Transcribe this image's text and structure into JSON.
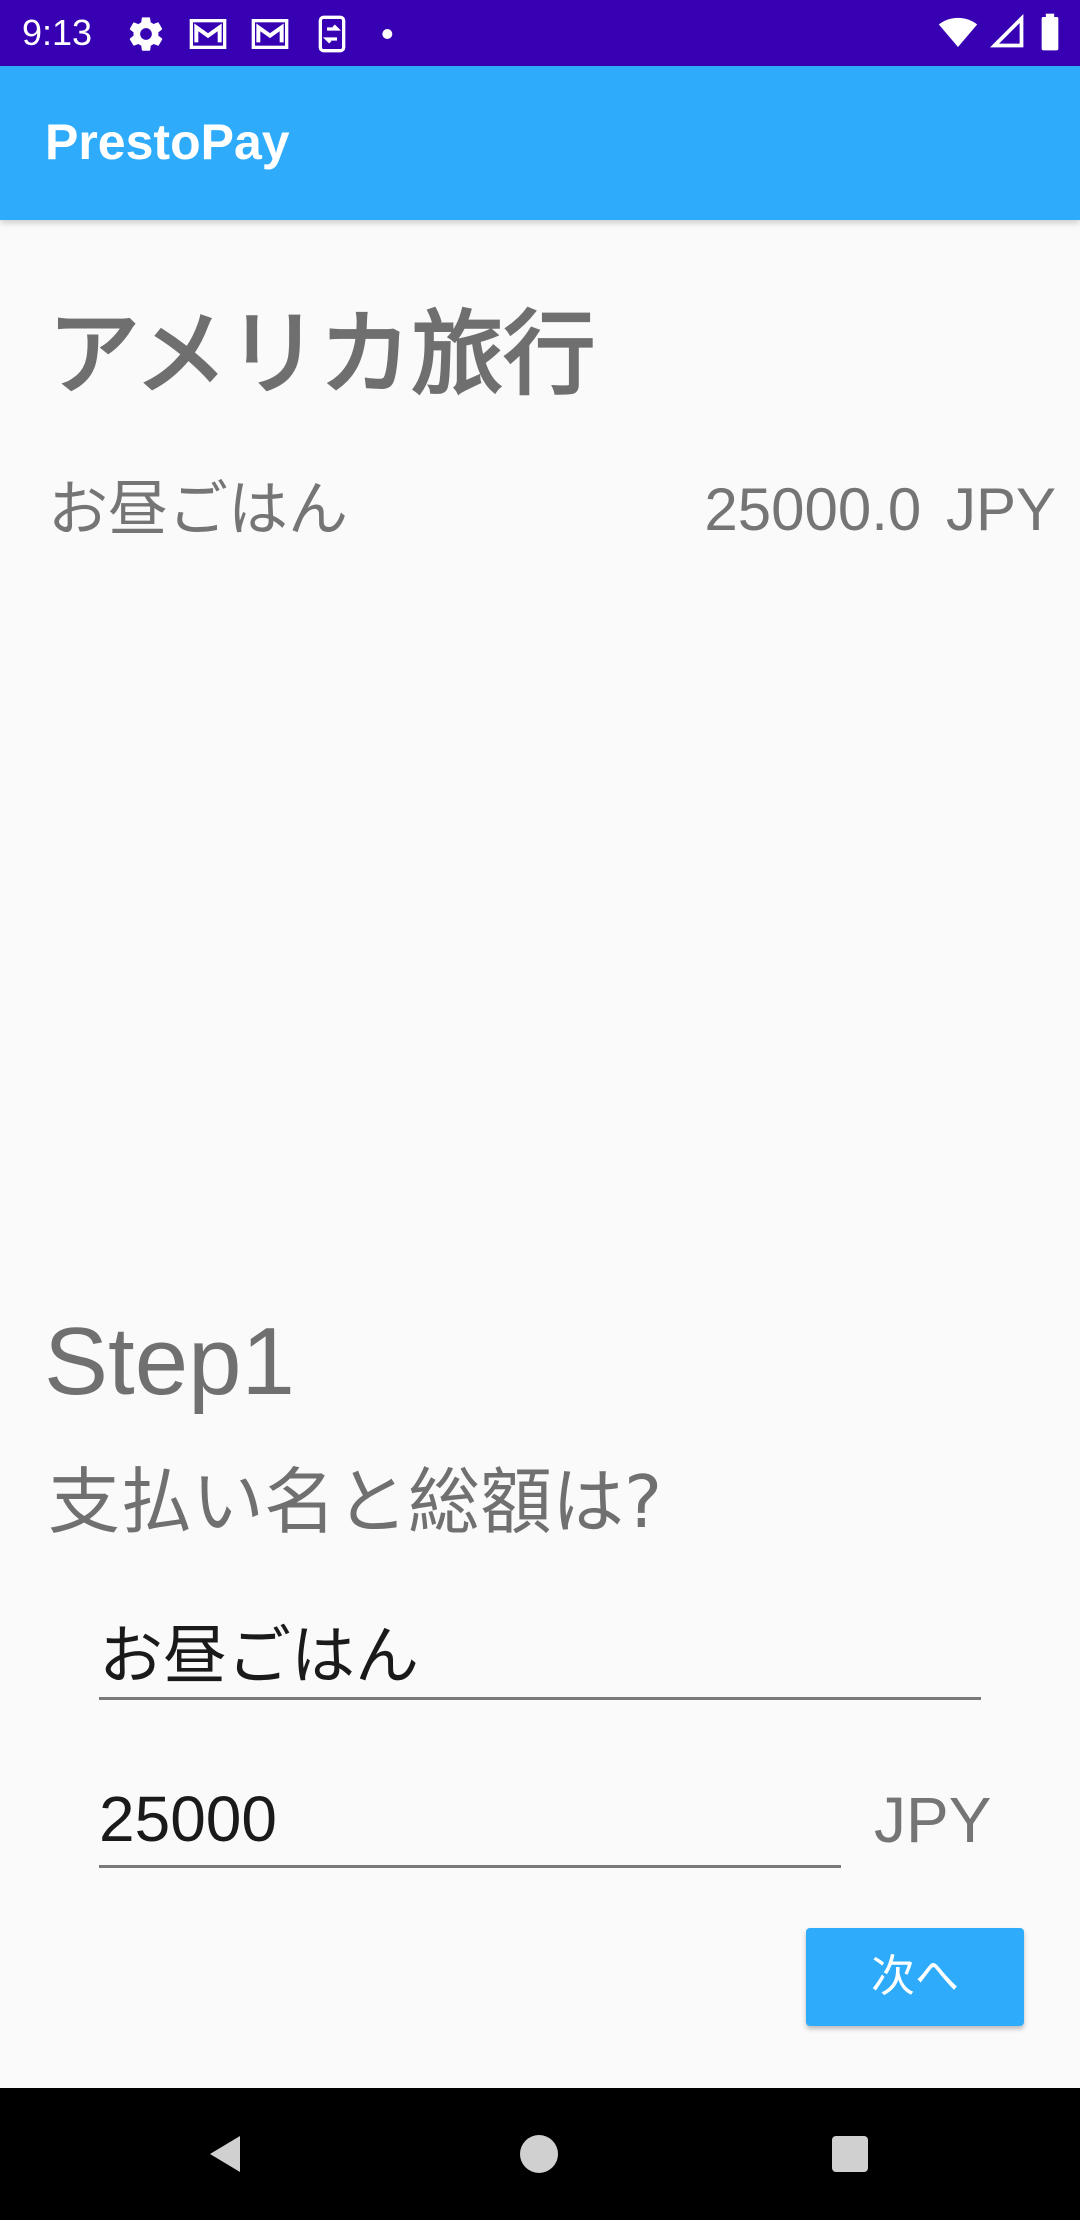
{
  "status_bar": {
    "time": "9:13",
    "left_icons": [
      "gear-icon",
      "gmail-icon",
      "gmail-icon",
      "sync-icon",
      "dot-icon"
    ],
    "right_icons": [
      "wifi-icon",
      "cellular-signal-icon",
      "battery-icon"
    ],
    "background_color": "#3700B3"
  },
  "app_bar": {
    "title": "PrestoPay",
    "background_color": "#2EACFB"
  },
  "trip": {
    "title": "アメリカ旅行"
  },
  "payments": [
    {
      "name": "お昼ごはん",
      "amount": "25000.0 JPY"
    }
  ],
  "step": {
    "label": "Step1",
    "question": "支払い名と総額は?"
  },
  "form": {
    "payment_name_value": "お昼ごはん",
    "amount_value": "25000",
    "currency": "JPY",
    "next_button_label": "次へ"
  },
  "nav_bar": {
    "buttons": [
      "back-icon",
      "home-icon",
      "recents-icon"
    ]
  }
}
